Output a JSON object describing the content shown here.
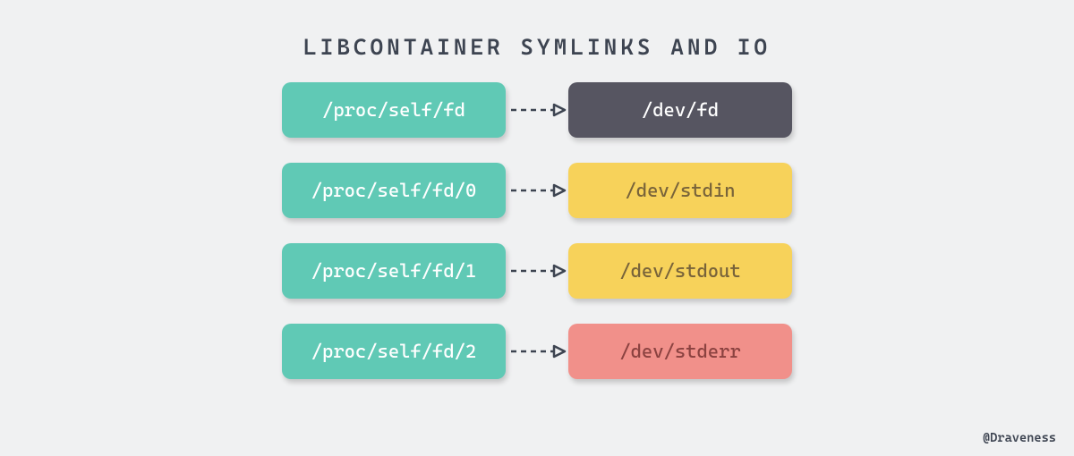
{
  "title": "LIBCONTAINER SYMLINKS AND IO",
  "rows": [
    {
      "source": "/proc/self/fd",
      "target": "/dev/fd",
      "targetClass": "box-dark"
    },
    {
      "source": "/proc/self/fd/0",
      "target": "/dev/stdin",
      "targetClass": "box-yellow"
    },
    {
      "source": "/proc/self/fd/1",
      "target": "/dev/stdout",
      "targetClass": "box-yellow"
    },
    {
      "source": "/proc/self/fd/2",
      "target": "/dev/stderr",
      "targetClass": "box-red"
    }
  ],
  "credit": "@Draveness"
}
